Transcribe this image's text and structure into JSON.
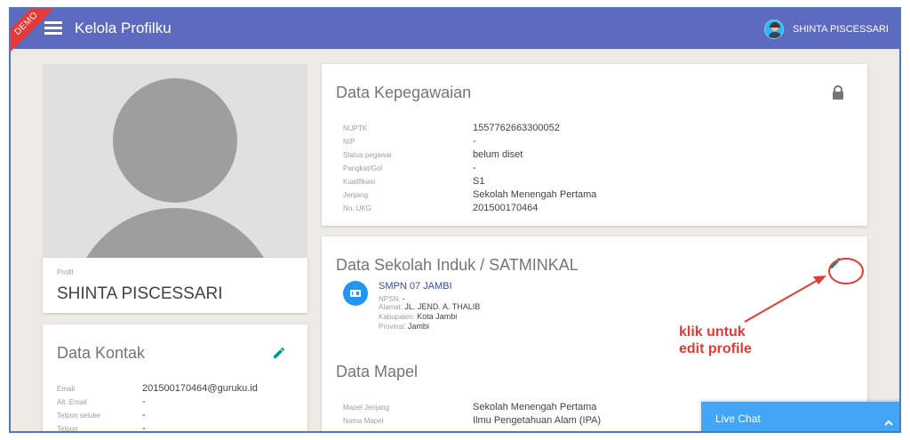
{
  "header": {
    "demo_badge": "DEMO",
    "title": "Kelola Profilku",
    "user_name": "SHINTA PISCESSARI"
  },
  "profile": {
    "label": "Profil",
    "name": "SHINTA PISCESSARI"
  },
  "kontak": {
    "title": "Data Kontak",
    "fields": [
      {
        "label": "Email",
        "value": "201500170464@guruku.id"
      },
      {
        "label": "Alt. Email",
        "value": "-"
      },
      {
        "label": "Telpon seluler",
        "value": "-"
      },
      {
        "label": "Telpon",
        "value": "-"
      }
    ]
  },
  "kepegawaian": {
    "title": "Data Kepegawaian",
    "fields": [
      {
        "label": "NUPTK",
        "value": "1557762663300052"
      },
      {
        "label": "NIP",
        "value": "-"
      },
      {
        "label": "Status pegawai",
        "value": "belum diset"
      },
      {
        "label": "Pangkat/Gol",
        "value": "-"
      },
      {
        "label": "Kualifikasi",
        "value": "S1"
      },
      {
        "label": "Jenjang",
        "value": "Sekolah Menengah Pertama"
      },
      {
        "label": "No. UKG",
        "value": "201500170464"
      }
    ]
  },
  "sekolah": {
    "title": "Data Sekolah Induk / SATMINKAL",
    "school_name": "SMPN 07 JAMBI",
    "npsn_label": "NPSN:",
    "npsn": "-",
    "alamat_label": "Alamat:",
    "alamat": "JL. JEND. A. THALIB",
    "kabupaten_label": "Kabupaten:",
    "kabupaten": "Kota Jambi",
    "provinsi_label": "Provinsi:",
    "provinsi": "Jambi"
  },
  "mapel": {
    "title": "Data Mapel",
    "fields": [
      {
        "label": "Mapel Jenjang",
        "value": "Sekolah Menengah Pertama"
      },
      {
        "label": "Nama Mapel",
        "value": "Ilmu Pengetahuan Alam (IPA)"
      }
    ]
  },
  "annotation": {
    "line1": "klik untuk",
    "line2": "edit profile"
  },
  "live_chat": {
    "label": "Live Chat"
  },
  "colors": {
    "topbar": "#5c6bc0",
    "accent_teal": "#009688",
    "annotation_red": "#e53935",
    "chat_blue": "#42a5f5"
  },
  "icons": [
    "hamburger-menu-icon",
    "avatar",
    "pencil-icon",
    "lock-icon",
    "school-icon",
    "chevron-up-icon"
  ]
}
